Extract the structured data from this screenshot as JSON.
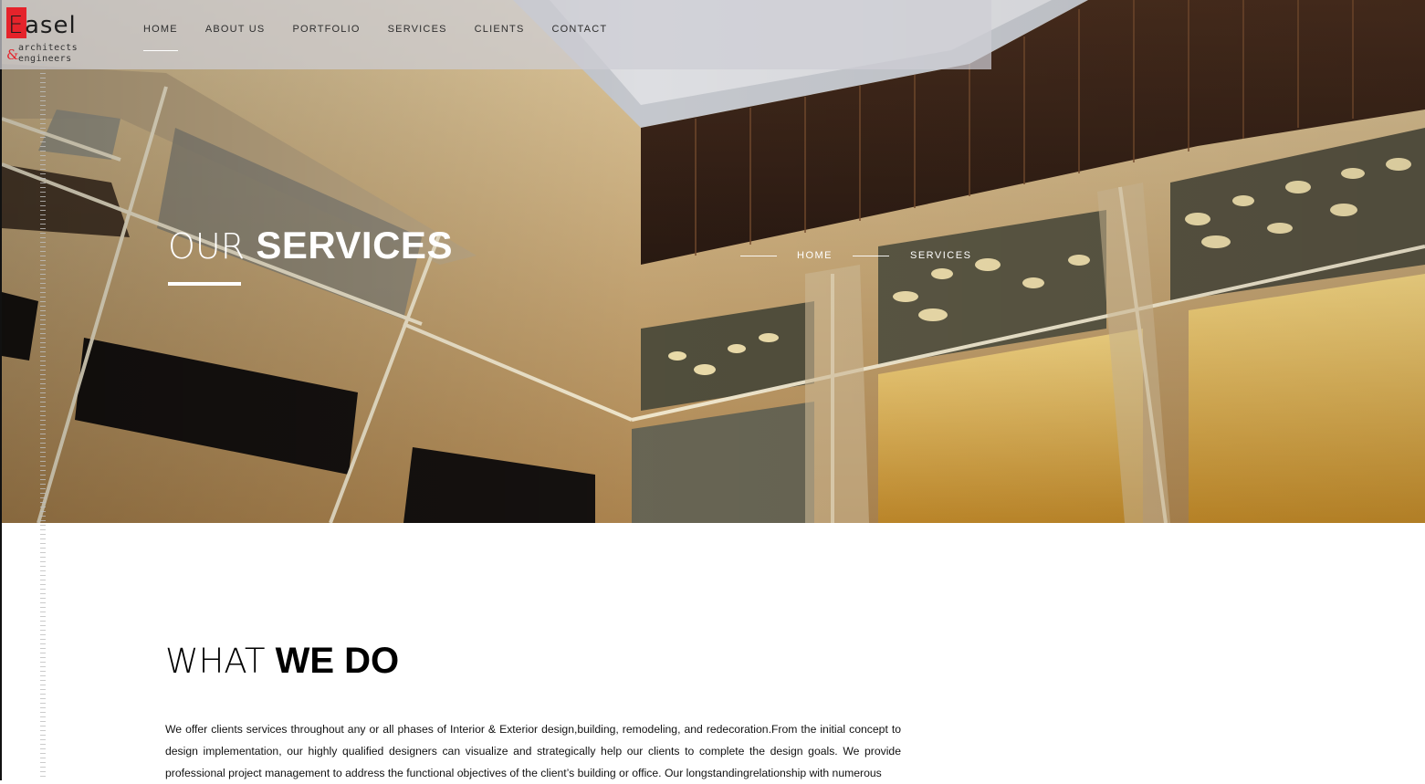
{
  "brand": {
    "logo_initial": "E",
    "logo_word": "asel",
    "logo_amp": "&",
    "tagline_line1": "architects",
    "tagline_line2": "engineers",
    "accent_color": "#e5232b"
  },
  "nav": {
    "items": [
      {
        "label": "HOME",
        "active": true
      },
      {
        "label": "ABOUT US"
      },
      {
        "label": "PORTFOLIO"
      },
      {
        "label": "SERVICES"
      },
      {
        "label": "CLIENTS"
      },
      {
        "label": "CONTACT"
      }
    ]
  },
  "hero": {
    "title_light": "OUR",
    "title_bold": "SERVICES",
    "breadcrumb": {
      "home": "HOME",
      "current": "SERVICES"
    }
  },
  "section": {
    "title_light": "WHAT",
    "title_bold": "WE DO",
    "paragraph": "We offer clients services throughout any or all phases of Interior & Exterior design,building, remodeling, and redecoration.From the initial concept to design implementation, our highly qualified designers can visualize and strategically help our clients to complete the design goals. We provide professional project management to address the functional objectives of the client’s building or office. Our longstandingrelationship with numerous"
  }
}
